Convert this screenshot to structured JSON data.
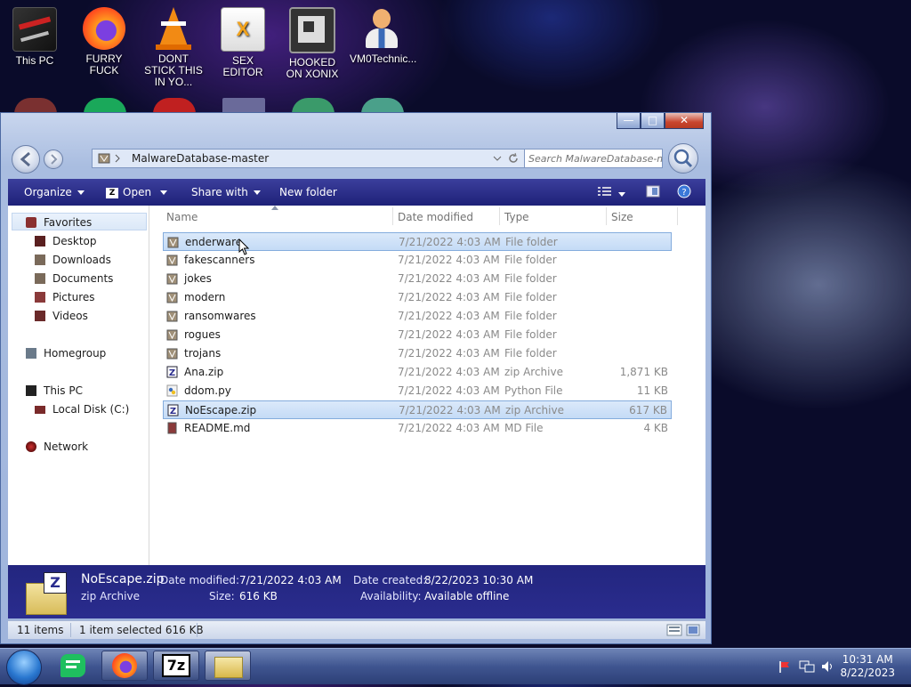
{
  "desktop": {
    "icons": [
      {
        "label": "This PC"
      },
      {
        "label": "FURRY FUCK"
      },
      {
        "label": "DONT STICK THIS IN YO..."
      },
      {
        "label": "SEX EDITOR"
      },
      {
        "label": "HOOKED ON XONIX"
      },
      {
        "label": "VM0Technic..."
      }
    ]
  },
  "window": {
    "controls": {
      "minimize": "—",
      "maximize": "□",
      "close": "✕"
    },
    "address": "MalwareDatabase-master",
    "search_placeholder": "Search MalwareDatabase-m..."
  },
  "toolbar": {
    "organize": "Organize",
    "open": "Open",
    "share_with": "Share with",
    "new_folder": "New folder"
  },
  "nav": {
    "favorites": "Favorites",
    "desktop": "Desktop",
    "downloads": "Downloads",
    "documents": "Documents",
    "pictures": "Pictures",
    "videos": "Videos",
    "homegroup": "Homegroup",
    "this_pc": "This PC",
    "local_disk": "Local Disk (C:)",
    "network": "Network"
  },
  "columns": {
    "name": "Name",
    "date": "Date modified",
    "type": "Type",
    "size": "Size"
  },
  "files": [
    {
      "name": "enderware",
      "date": "7/21/2022 4:03 AM",
      "type": "File folder",
      "size": ""
    },
    {
      "name": "fakescanners",
      "date": "7/21/2022 4:03 AM",
      "type": "File folder",
      "size": ""
    },
    {
      "name": "jokes",
      "date": "7/21/2022 4:03 AM",
      "type": "File folder",
      "size": ""
    },
    {
      "name": "modern",
      "date": "7/21/2022 4:03 AM",
      "type": "File folder",
      "size": ""
    },
    {
      "name": "ransomwares",
      "date": "7/21/2022 4:03 AM",
      "type": "File folder",
      "size": ""
    },
    {
      "name": "rogues",
      "date": "7/21/2022 4:03 AM",
      "type": "File folder",
      "size": ""
    },
    {
      "name": "trojans",
      "date": "7/21/2022 4:03 AM",
      "type": "File folder",
      "size": ""
    },
    {
      "name": "Ana.zip",
      "date": "7/21/2022 4:03 AM",
      "type": "zip Archive",
      "size": "1,871 KB"
    },
    {
      "name": "ddom.py",
      "date": "7/21/2022 4:03 AM",
      "type": "Python File",
      "size": "11 KB"
    },
    {
      "name": "NoEscape.zip",
      "date": "7/21/2022 4:03 AM",
      "type": "zip Archive",
      "size": "617 KB"
    },
    {
      "name": "README.md",
      "date": "7/21/2022 4:03 AM",
      "type": "MD File",
      "size": "4 KB"
    }
  ],
  "details": {
    "filename": "NoEscape.zip",
    "filetype": "zip Archive",
    "date_modified_label": "Date modified:",
    "date_modified": "7/21/2022 4:03 AM",
    "size_label": "Size:",
    "size": "616 KB",
    "date_created_label": "Date created:",
    "date_created": "8/22/2023 10:30 AM",
    "availability_label": "Availability:",
    "availability": "Available offline",
    "icon_letter": "Z"
  },
  "status": {
    "items": "11 items",
    "selected": "1 item selected  616 KB"
  },
  "taskbar": {
    "time": "10:31 AM",
    "date": "8/22/2023",
    "sevenzip_label": "7z"
  },
  "colors": {
    "toolbar": "#2a2c8e",
    "selection": "#c4dbf6",
    "folder": "#a09078"
  }
}
